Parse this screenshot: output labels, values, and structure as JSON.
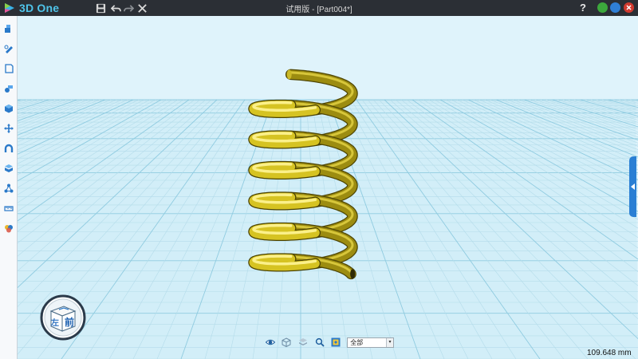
{
  "app": {
    "name": "3D One",
    "window_title": "试用版 - [Part004*]",
    "help_label": "?"
  },
  "colors": {
    "titlebar_bg": "#2b2f35",
    "accent": "#4fc4ea",
    "viewport_bg": "#dff3fb",
    "grid_line": "#b4dcea",
    "grid_major": "#8fcbe0",
    "spring": "#d6c322",
    "minimize": "#3ca83c",
    "maximize": "#2f7fd6",
    "close": "#d13a2f",
    "side_tab": "#2a7fd4"
  },
  "quick_access": [
    {
      "name": "save-icon",
      "icon": "floppy"
    },
    {
      "name": "undo-icon",
      "icon": "arrow-left"
    },
    {
      "name": "redo-icon",
      "icon": "arrow-right"
    },
    {
      "name": "cancel-icon",
      "icon": "x"
    }
  ],
  "toolbar": [
    {
      "name": "basic-shapes-icon",
      "icon": "shapes"
    },
    {
      "name": "sketch-icon",
      "icon": "pencil"
    },
    {
      "name": "sketch-edit-icon",
      "icon": "page"
    },
    {
      "name": "special-features-icon",
      "icon": "wrench"
    },
    {
      "name": "feature-modeling-icon",
      "icon": "cube"
    },
    {
      "name": "transform-icon",
      "icon": "move"
    },
    {
      "name": "magnet-icon",
      "icon": "magnet"
    },
    {
      "name": "group-icon",
      "icon": "layers"
    },
    {
      "name": "array-icon",
      "icon": "nodes"
    },
    {
      "name": "measure-icon",
      "icon": "ruler"
    },
    {
      "name": "material-render-icon",
      "icon": "palette"
    }
  ],
  "viewcube": {
    "left_face": "左",
    "front_face": "前"
  },
  "bottom_bar": {
    "icons": [
      "view-icon",
      "wireframe-icon",
      "layers-icon",
      "zoom-icon",
      "filter-icon"
    ],
    "filter_value": "全部"
  },
  "status": {
    "scale_readout": "109.648 mm"
  }
}
